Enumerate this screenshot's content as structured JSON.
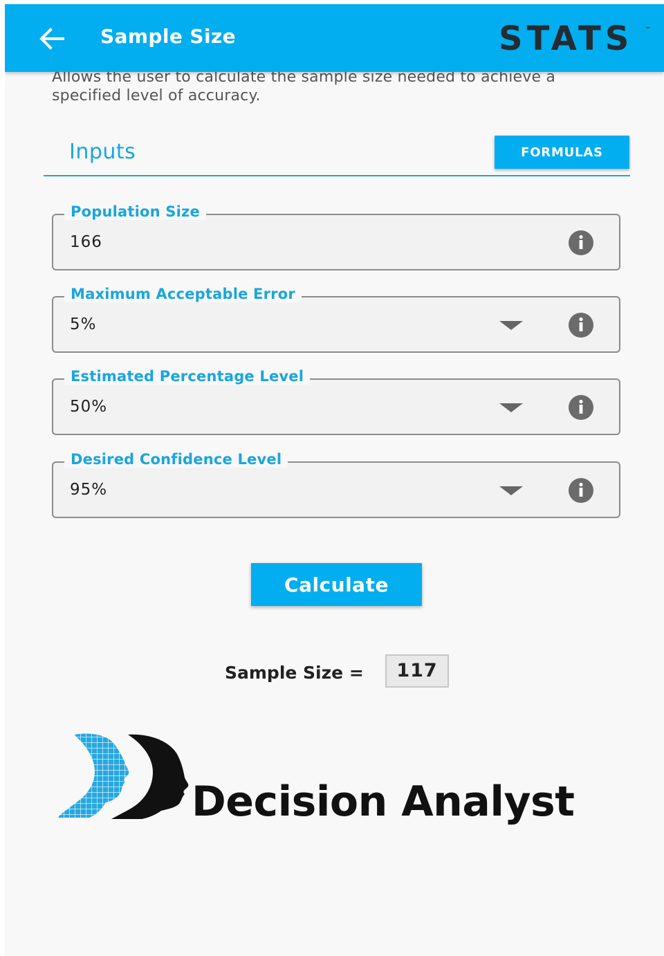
{
  "appbar": {
    "title": "Sample Size",
    "logo_text": "STATS",
    "logo_tm": "™",
    "back_icon": "arrow-left-icon",
    "background": "#02aeef"
  },
  "description": "Allows the user to calculate the sample size needed to achieve a specified level of accuracy.",
  "inputs": {
    "section_title": "Inputs",
    "formulas_label": "FORMULAS",
    "fields": [
      {
        "label": "Population Size",
        "value": "166",
        "type": "text"
      },
      {
        "label": "Maximum Acceptable Error",
        "value": "5%",
        "type": "dropdown"
      },
      {
        "label": "Estimated Percentage Level",
        "value": "50%",
        "type": "dropdown"
      },
      {
        "label": "Desired Confidence Level",
        "value": "95%",
        "type": "dropdown"
      }
    ]
  },
  "calculate_label": "Calculate",
  "result": {
    "label": "Sample Size =",
    "value": "117"
  },
  "brand": {
    "name": "Decision Analyst",
    "logo_icon": "decision-analyst-logo-icon"
  },
  "colors": {
    "accent": "#02aeef",
    "label": "#19a6dc",
    "icon": "#6b6b6b"
  }
}
